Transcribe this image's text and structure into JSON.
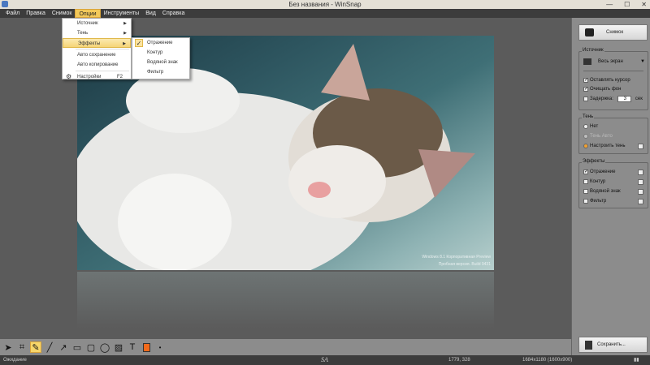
{
  "window": {
    "title": "Без названия - WinSnap",
    "controls": [
      "—",
      "☐",
      "✕"
    ]
  },
  "menu": [
    "Файл",
    "Правка",
    "Снимок",
    "Опции",
    "Инструменты",
    "Вид",
    "Справка"
  ],
  "options_menu": {
    "items": [
      {
        "label": "Источник",
        "submenu": true
      },
      {
        "label": "Тень",
        "submenu": true
      },
      {
        "label": "Эффекты",
        "submenu": true,
        "highlighted": true
      },
      {
        "label": "Авто сохранение"
      },
      {
        "label": "Авто копирование"
      },
      {
        "label": "Настройки",
        "shortcut": "F2"
      }
    ]
  },
  "effects_submenu": {
    "items": [
      {
        "label": "Отражение",
        "checked": true
      },
      {
        "label": "Контур"
      },
      {
        "label": "Водяной знак"
      },
      {
        "label": "Фильтр"
      }
    ]
  },
  "watermark": {
    "line1": "Windows 8.1 Корпоративная Preview",
    "line2": "Пробная версия. Build 9431"
  },
  "panel": {
    "snap_button": "Снимок",
    "source": {
      "legend": "Источник",
      "value": "Весь экран",
      "keep_cursor": "Оставлять курсор",
      "clear_bg": "Очищать фон",
      "delay": "Задержка:",
      "delay_value": "3",
      "sec": "сек"
    },
    "shadow": {
      "legend": "Тень",
      "none": "Нет",
      "auto": "Тень Авто",
      "custom": "Настроить тень"
    },
    "effects": {
      "legend": "Эффекты",
      "reflection": "Отражение",
      "outline": "Контур",
      "watermark": "Водяной знак",
      "filter": "Фильтр"
    },
    "save_button": "Сохранить..."
  },
  "status": {
    "state": "Ожидание",
    "logo": "SA",
    "coords": "1779, 328",
    "size": "1684x1180 (1600x900)"
  },
  "colors": {
    "accent": "#f7d66a",
    "draw_color": "#f26a1b"
  }
}
